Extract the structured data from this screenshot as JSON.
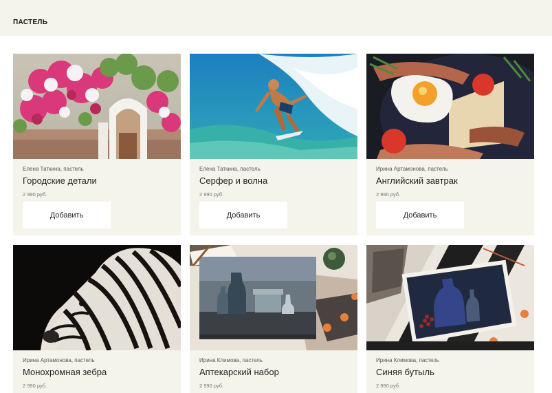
{
  "header": {
    "title": "ПАСТЕЛЬ"
  },
  "products": [
    {
      "author": "Елена Таткина, пастель",
      "title": "Городские детали",
      "price": "2 990 руб.",
      "button": "Добавить"
    },
    {
      "author": "Елена Таткина, пастель",
      "title": "Серфер и волна",
      "price": "2 990 руб.",
      "button": "Добавить"
    },
    {
      "author": "Ирина Артамонова, пастель",
      "title": "Английский завтрак",
      "price": "2 990 руб.",
      "button": "Добавить"
    },
    {
      "author": "Ирина Артамонова, пастель",
      "title": "Монохромная зебра",
      "price": "2 990 руб."
    },
    {
      "author": "Ирина Климова, пастель",
      "title": "Аптекарский набор",
      "price": "2 990 руб."
    },
    {
      "author": "Ирина Климова, пастель",
      "title": "Синяя бутыль",
      "price": "2 990 руб."
    }
  ]
}
